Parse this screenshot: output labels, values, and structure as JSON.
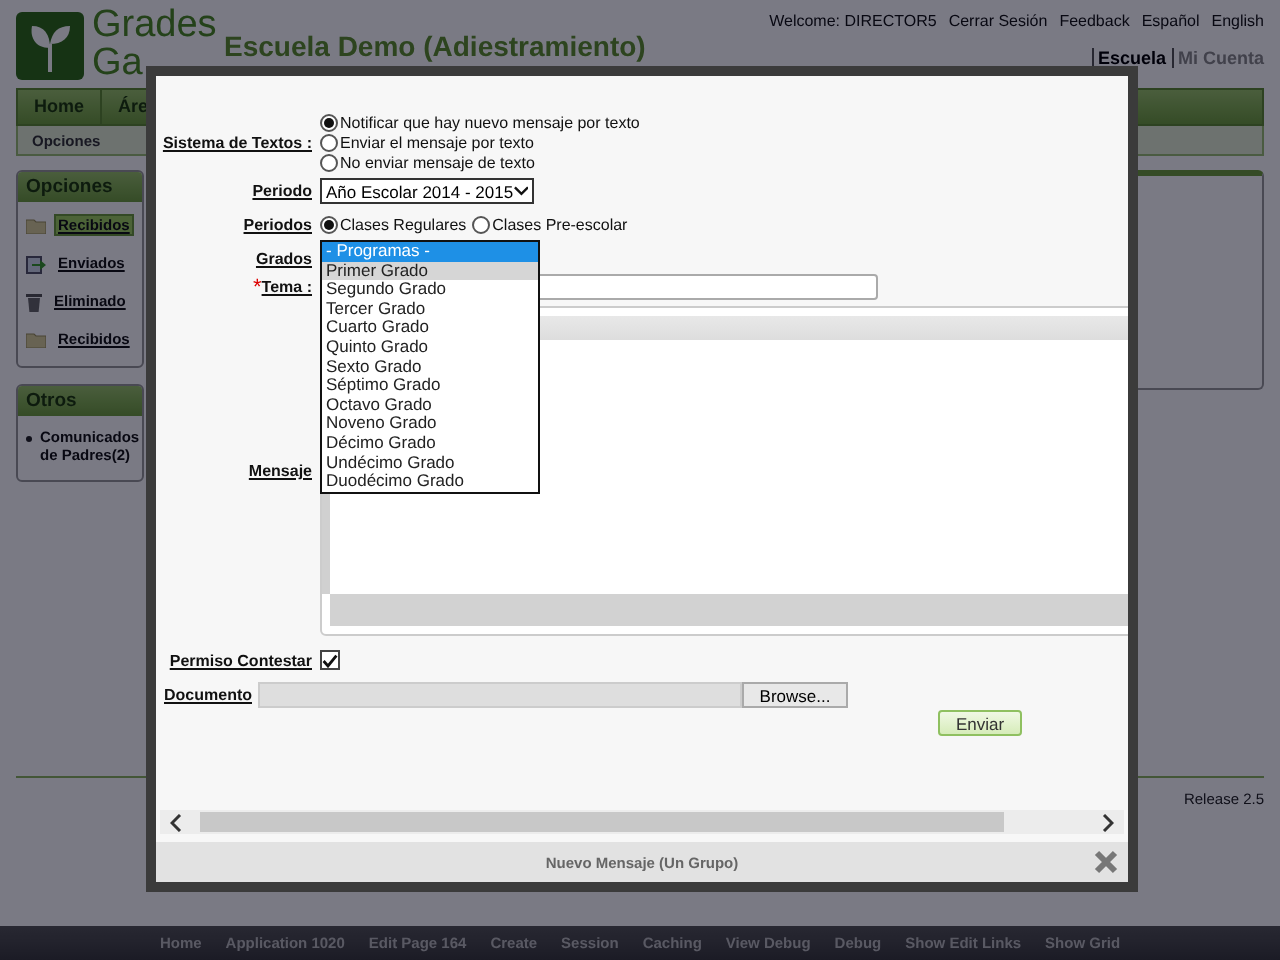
{
  "header": {
    "logo": {
      "line_1": "Grades",
      "line_2": "Ga"
    },
    "school": "Escuela Demo (Adiestramiento)",
    "top_links": [
      "Welcome: DIRECTOR5",
      "Cerrar Sesión",
      "Feedback",
      "Español",
      "English"
    ],
    "account_links": [
      {
        "label": "Escuela",
        "selected": true
      },
      {
        "label": "Mi Cuenta",
        "selected": false
      }
    ]
  },
  "nav": {
    "tabs": [
      {
        "label": "Home"
      },
      {
        "label": "Áre"
      }
    ],
    "subnav": [
      "Opciones"
    ]
  },
  "sidebar": [
    {
      "title": "Opciones",
      "items": [
        {
          "label": "Recibidos",
          "kind": "folder",
          "selected": true
        },
        {
          "label": "Enviados",
          "kind": "sent",
          "selected": false
        },
        {
          "label": "Eliminado",
          "kind": "trash",
          "selected": false
        },
        {
          "label": "Recibidos",
          "kind": "folder",
          "selected": false
        }
      ]
    },
    {
      "title": "Otros",
      "items": [
        {
          "label": "Comunicados de Padres(2)",
          "kind": "bullet"
        }
      ]
    }
  ],
  "release": "Release 2.5",
  "footer_links": [
    "Home",
    "Application 1020",
    "Edit Page 164",
    "Create",
    "Session",
    "Caching",
    "View Debug",
    "Debug",
    "Show Edit Links",
    "Show Grid"
  ],
  "dialog": {
    "title": "Nuevo Mensaje (Un Grupo)",
    "text_system": {
      "label": "Sistema de Textos :",
      "options": [
        {
          "label": "Notificar que hay nuevo mensaje por texto",
          "selected": true
        },
        {
          "label": "Enviar el mensaje por texto",
          "selected": false
        },
        {
          "label": "No enviar mensaje de texto",
          "selected": false
        }
      ]
    },
    "period": {
      "label": "Periodo",
      "value": "Año Escolar 2014 - 2015"
    },
    "periods": {
      "label": "Periodos",
      "options": [
        {
          "label": "Clases Regulares",
          "selected": true
        },
        {
          "label": "Clases Pre-escolar",
          "selected": false
        }
      ]
    },
    "grades": {
      "label": "Grados",
      "options": [
        {
          "label": "- Programas -",
          "selected": true,
          "hovered": false
        },
        {
          "label": "Primer Grado",
          "selected": false,
          "hovered": true
        },
        {
          "label": "Segundo Grado",
          "selected": false,
          "hovered": false
        },
        {
          "label": "Tercer Grado",
          "selected": false,
          "hovered": false
        },
        {
          "label": "Cuarto Grado",
          "selected": false,
          "hovered": false
        },
        {
          "label": "Quinto Grado",
          "selected": false,
          "hovered": false
        },
        {
          "label": "Sexto Grado",
          "selected": false,
          "hovered": false
        },
        {
          "label": "Séptimo Grado",
          "selected": false,
          "hovered": false
        },
        {
          "label": "Octavo Grado",
          "selected": false,
          "hovered": false
        },
        {
          "label": "Noveno Grado",
          "selected": false,
          "hovered": false
        },
        {
          "label": "Décimo Grado",
          "selected": false,
          "hovered": false
        },
        {
          "label": "Undécimo Grado",
          "selected": false,
          "hovered": false
        },
        {
          "label": "Duodécimo Grado",
          "selected": false,
          "hovered": false
        }
      ]
    },
    "subject": {
      "label": "Tema :",
      "required_mark": "*"
    },
    "message": {
      "label": "Mensaje"
    },
    "allow_reply": {
      "label": "Permiso Contestar",
      "checked": true
    },
    "document": {
      "label": "Documento",
      "button": "Browse..."
    },
    "submit": "Enviar"
  }
}
